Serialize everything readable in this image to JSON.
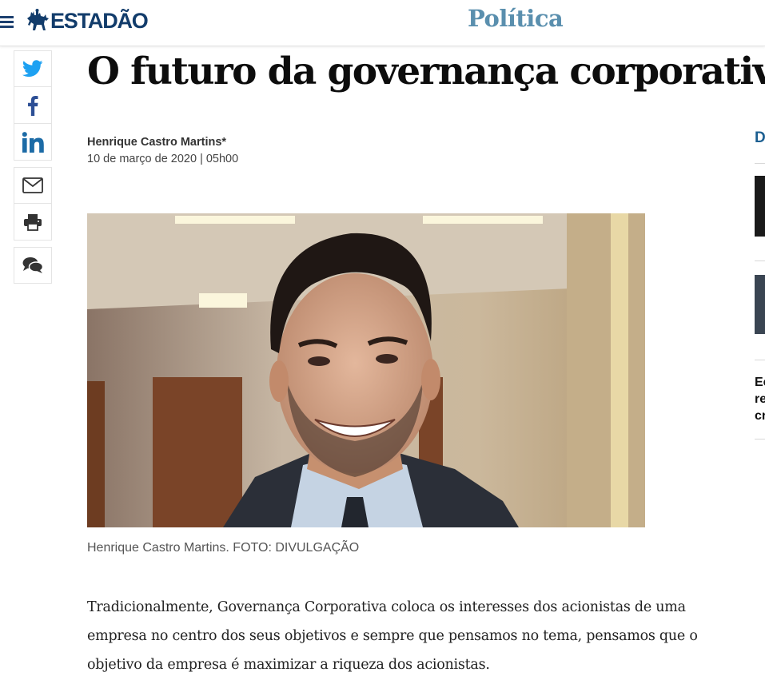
{
  "header": {
    "logo_text": "ESTADÃO",
    "section": "Política"
  },
  "share": {
    "items": [
      "twitter-icon",
      "facebook-icon",
      "linkedin-icon",
      "mail-icon",
      "print-icon",
      "comments-icon"
    ]
  },
  "article": {
    "headline": "O futuro da governança corporativa",
    "author": "Henrique Castro Martins*",
    "date": "10 de março de 2020 | 05h00",
    "caption": "Henrique Castro Martins. FOTO: DIVULGAÇÃO",
    "paragraph_lines": [
      "Tradicionalmente, Governança Corporativa coloca os interesses dos acionistas de uma",
      "empresa no centro dos seus objetivos e sempre que pensamos no tema, pensamos que o",
      "objetivo da empresa é maximizar a riqueza dos acionistas."
    ]
  },
  "rail": {
    "heading": "D",
    "text_lines": [
      "Ec",
      "re",
      "cr"
    ]
  },
  "colors": {
    "brand": "#123c6b",
    "section": "#5a8fae",
    "twitter": "#1da1f2",
    "facebook": "#2d4f95",
    "linkedin": "#1c6ba6"
  }
}
